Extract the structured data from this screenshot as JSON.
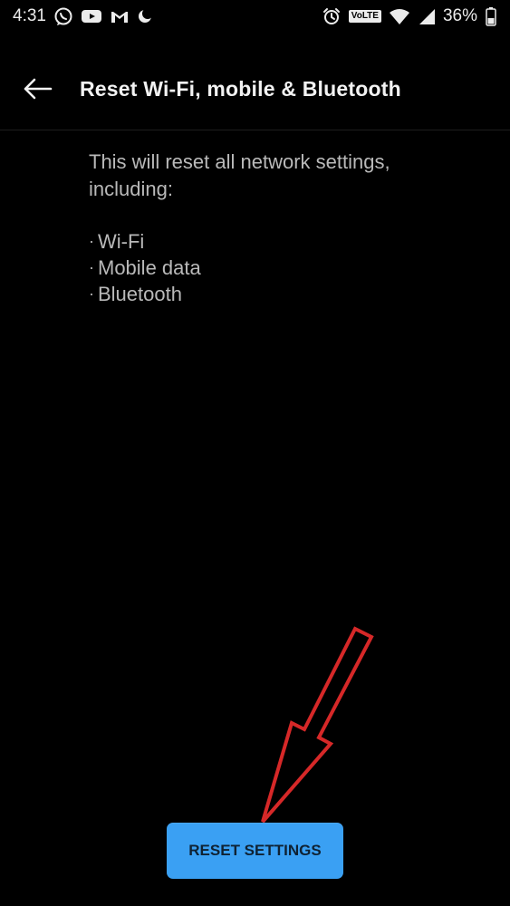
{
  "status_bar": {
    "time": "4:31",
    "left_icons": [
      "whatsapp-icon",
      "youtube-icon",
      "gmail-icon",
      "night-mode-icon"
    ],
    "right_icons": [
      "alarm-icon",
      "volte-icon",
      "wifi-icon",
      "signal-icon",
      "battery-icon"
    ],
    "volte_label": "VoLTE",
    "battery": "36%"
  },
  "app_bar": {
    "back_icon": "arrow-back-icon",
    "title": "Reset Wi-Fi, mobile & Bluetooth"
  },
  "content": {
    "description": "This will reset all network settings, including:",
    "items": [
      {
        "bullet": "·",
        "label": "Wi-Fi"
      },
      {
        "bullet": "·",
        "label": "Mobile data"
      },
      {
        "bullet": "·",
        "label": "Bluetooth"
      }
    ]
  },
  "action": {
    "button_label": "RESET SETTINGS"
  },
  "colors": {
    "background": "#000000",
    "title": "#f2f2f2",
    "body_text": "#b9b9b9",
    "button": "#3aa0f3",
    "annotation": "#d62828"
  }
}
